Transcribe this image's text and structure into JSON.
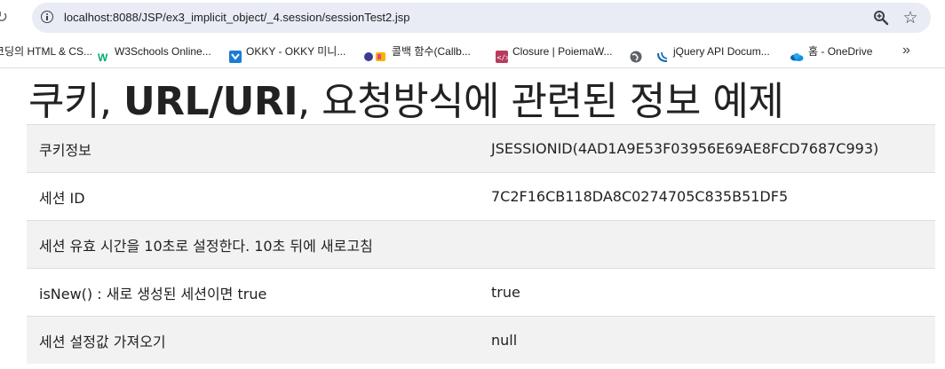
{
  "browser": {
    "url": "localhost:8088/JSP/ex3_implicit_object/_4.session/sessionTest2.jsp",
    "reload_icon": "reload-icon",
    "info_icon": "info-icon",
    "zoom_icon": "zoom-icon",
    "star_icon": "star-icon"
  },
  "bookmarks": [
    {
      "label": "코딩의 HTML & CS...",
      "icon": "none"
    },
    {
      "label": "W3Schools Online...",
      "icon": "w3schools-icon"
    },
    {
      "label": "OKKY - OKKY 미니...",
      "icon": "okky-icon"
    },
    {
      "label": "콜백 함수(Callb...",
      "icon": "blog-icon"
    },
    {
      "label": "Closure | PoiemaW...",
      "icon": "poiemaweb-icon"
    },
    {
      "label": "",
      "icon": "globe-icon"
    },
    {
      "label": "jQuery API Docum...",
      "icon": "jquery-icon"
    },
    {
      "label": "홈 - OneDrive",
      "icon": "onedrive-icon"
    }
  ],
  "page": {
    "title_part1": "쿠키, ",
    "title_part2": "URL/URI",
    "title_part3": ", 요청방식에 관련된 정보 예제",
    "rows": [
      {
        "label": "쿠키정보",
        "value": "JSESSIONID(4AD1A9E53F03956E69AE8FCD7687C993)"
      },
      {
        "label": "세션 ID",
        "value": "7C2F16CB118DA8C0274705C835B51DF5"
      },
      {
        "label": "세션 유효 시간을 10초로 설정한다. 10초 뒤에 새로고침",
        "value": ""
      },
      {
        "label": "isNew() : 새로 생성된 세션이면 true",
        "value": "true"
      },
      {
        "label": "세션 설정값 가져오기",
        "value": "null"
      }
    ]
  },
  "colors": {
    "omnibox_bg": "#e9ecf5",
    "row_alt_bg": "#f2f2f2",
    "text": "#222222"
  }
}
